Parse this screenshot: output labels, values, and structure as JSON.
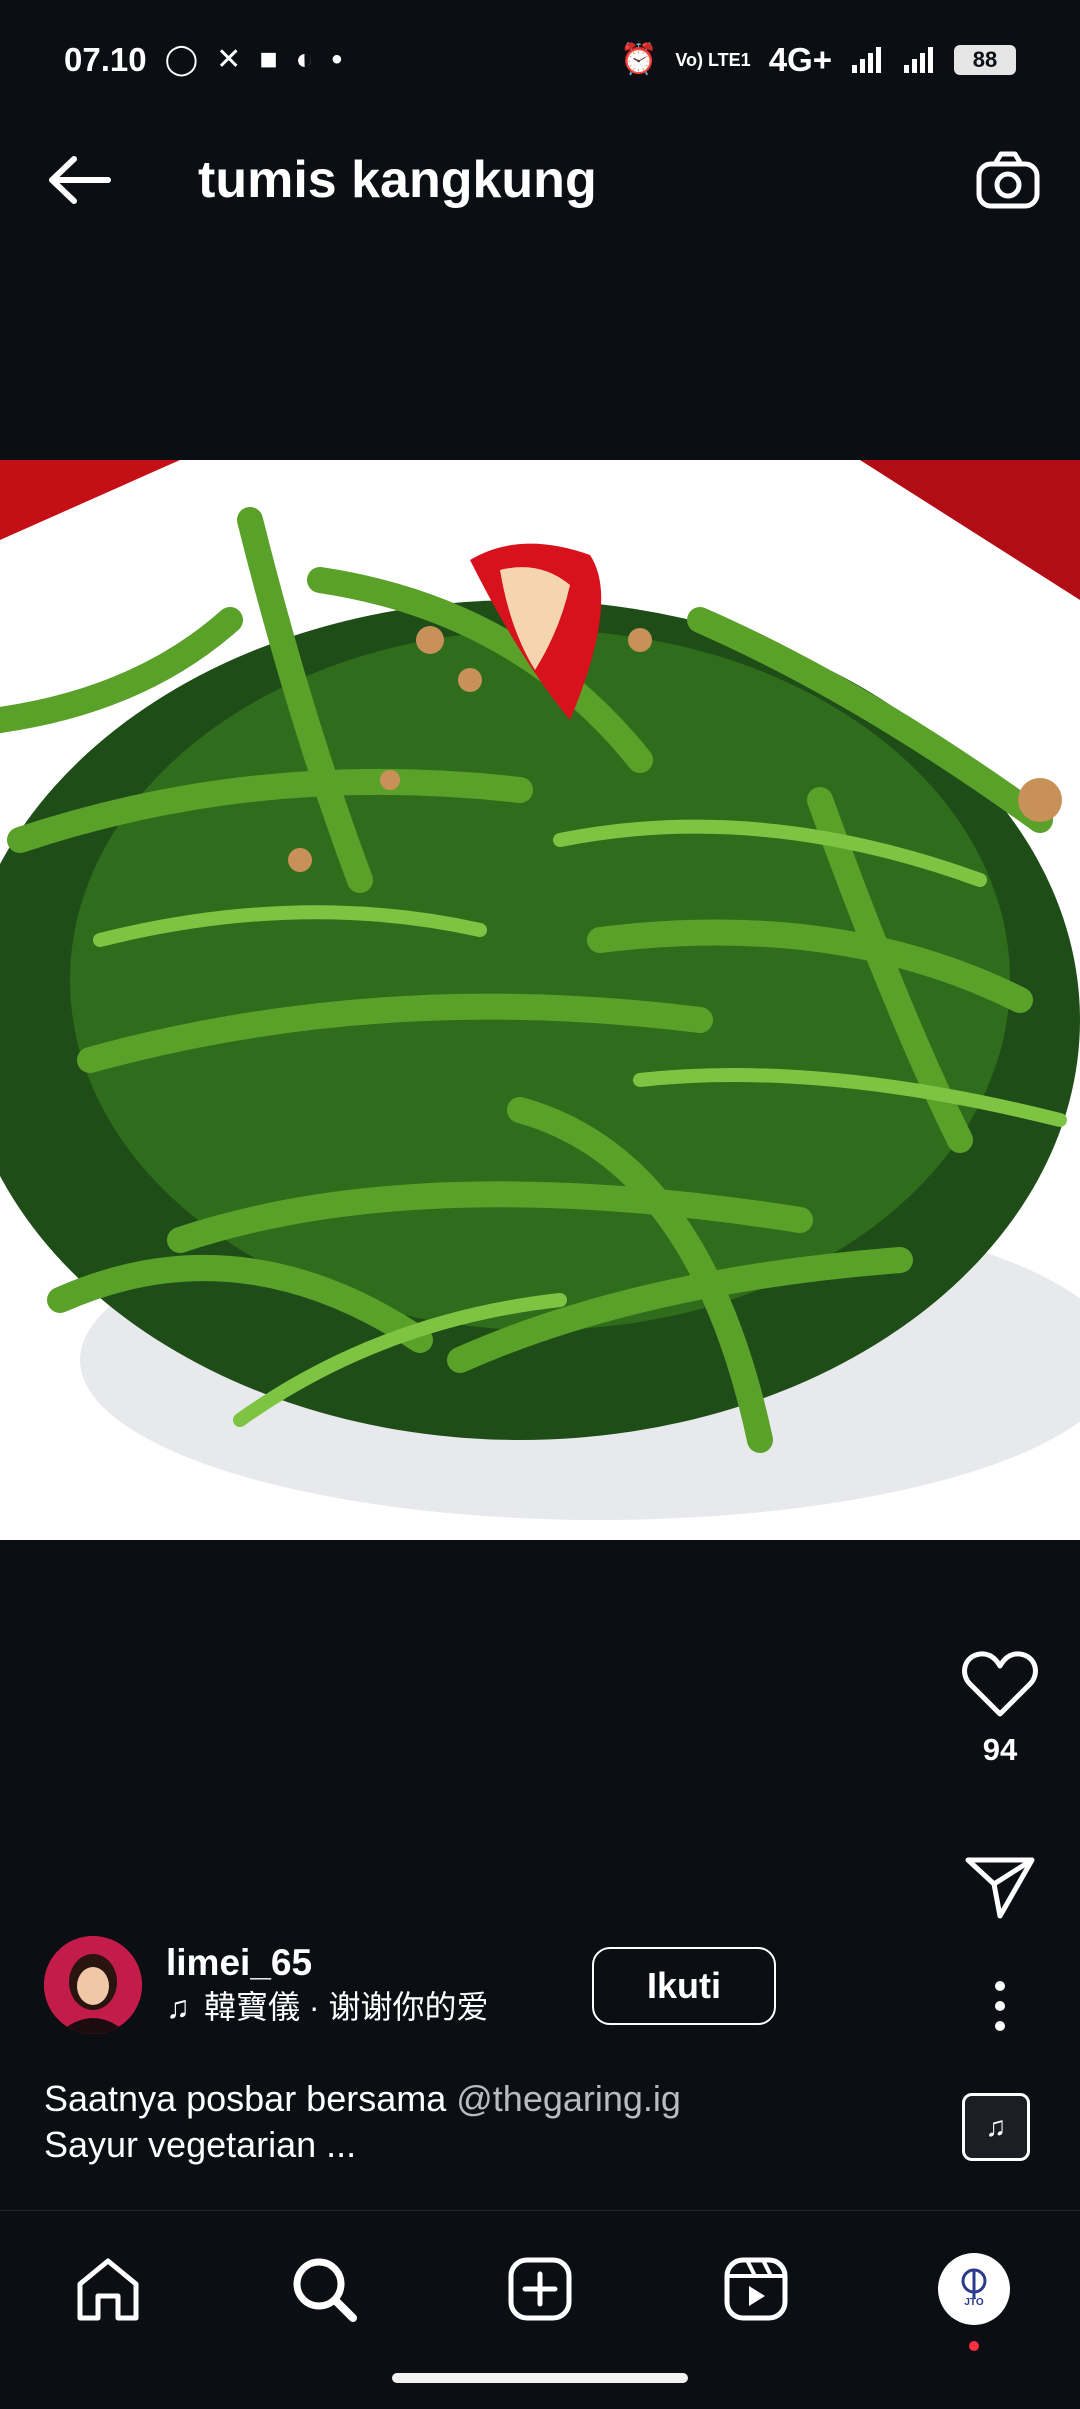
{
  "status_bar": {
    "time": "07.10",
    "network": "4G+",
    "volte": "Vo) LTE1",
    "battery": "88",
    "icons": [
      "whatsapp-icon",
      "missed-call-icon",
      "shopping-bag-icon",
      "compass-icon",
      "dot-icon",
      "alarm-icon",
      "volte-icon",
      "signal-icon",
      "signal-icon",
      "battery-icon"
    ]
  },
  "header": {
    "title": "tumis kangkung",
    "back_icon": "arrow-left-icon",
    "camera_icon": "camera-icon"
  },
  "post": {
    "image_alt": "",
    "likes": "94",
    "author": {
      "username": "limei_65",
      "audio_track": "韓寶儀 · 谢谢你的爱"
    },
    "follow_label": "Ikuti",
    "caption_line1": "Saatnya posbar bersama ",
    "caption_mention": "@thegaring.ig",
    "caption_line2": "Sayur vegetarian ..."
  },
  "bottom_nav": {
    "items": [
      "home-icon",
      "search-icon",
      "add-post-icon",
      "reels-icon",
      "profile-avatar"
    ],
    "profile_text": "JTO"
  },
  "colors": {
    "background": "#0b0f14",
    "text": "#ffffff",
    "mention": "#b8bcc2",
    "notification_dot": "#ff3040"
  }
}
